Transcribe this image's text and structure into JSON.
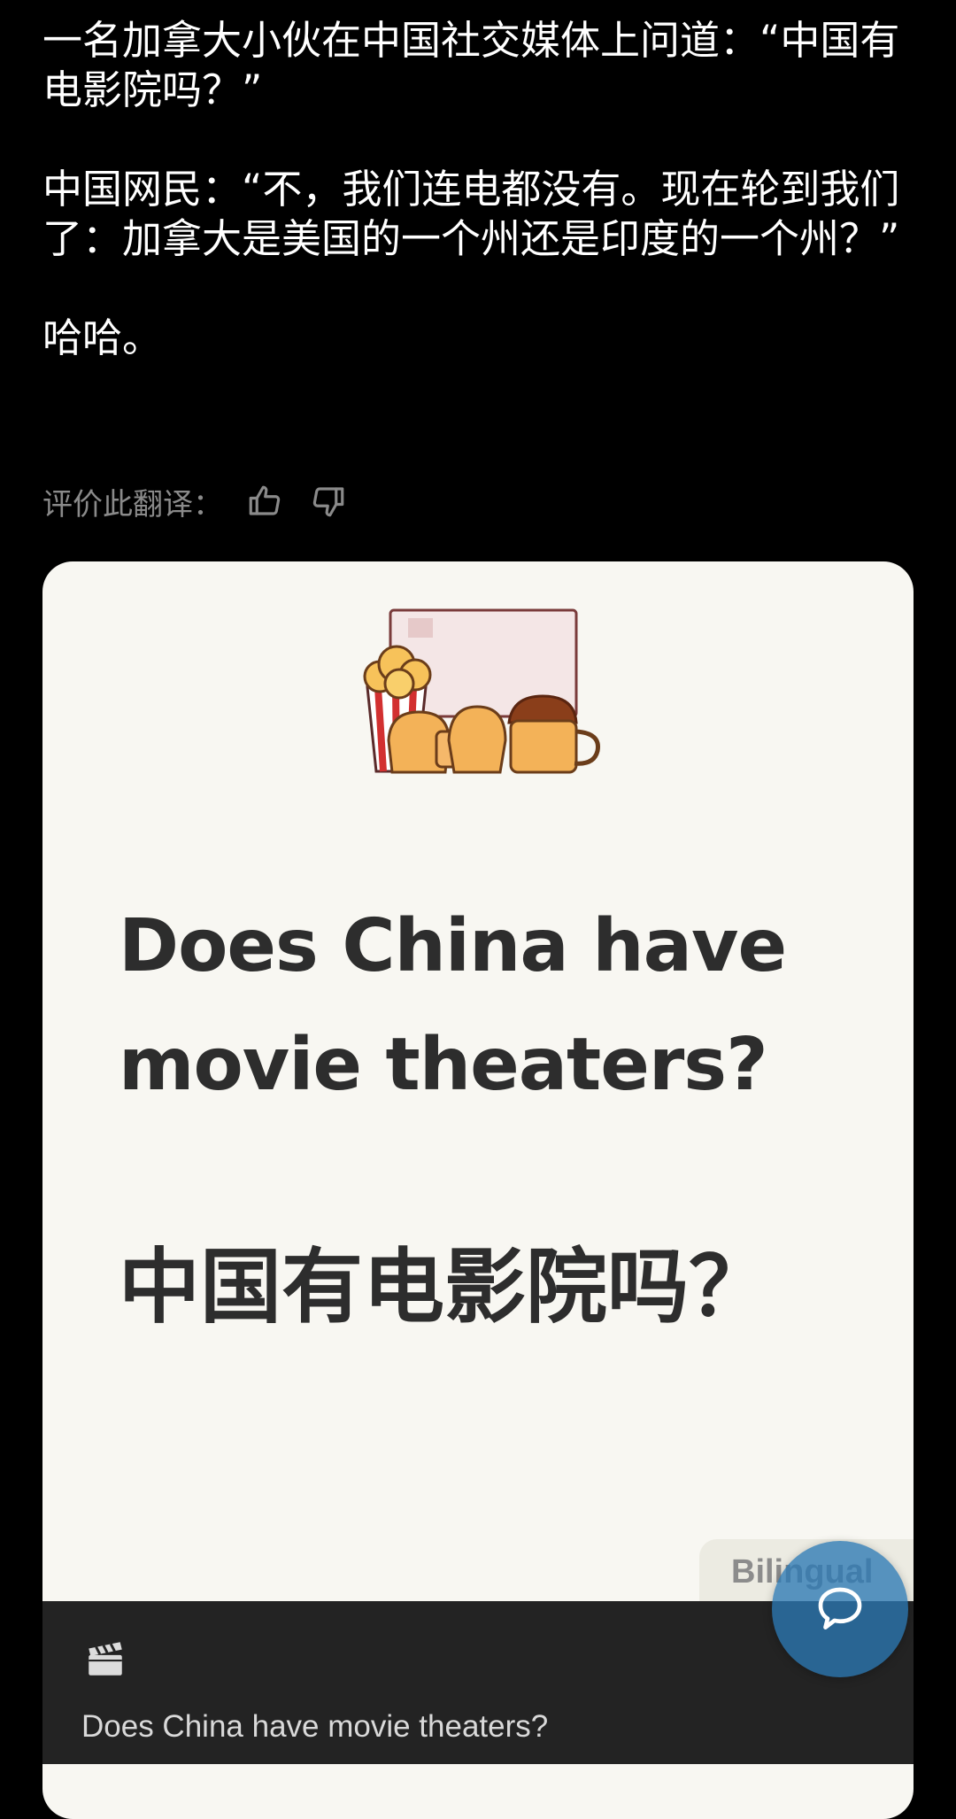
{
  "post": {
    "paragraphs": [
      "一名加拿大小伙在中国社交媒体上问道：“中国有电影院吗？”",
      "中国网民：“不，我们连电都没有。现在轮到我们了：加拿大是美国的一个州还是印度的一个州？”",
      "哈哈。"
    ]
  },
  "translation_rating": {
    "label": "评价此翻译：",
    "thumbs_up_icon": "thumbs-up-icon",
    "thumbs_down_icon": "thumbs-down-icon"
  },
  "card": {
    "title_en": "Does China have movie theaters?",
    "title_zh": "中国有电影院吗？",
    "tag": "Bilingual",
    "illustration_icon": "popcorn-snacks-illustration",
    "background_color": "#f8f7f2",
    "text_color": "#2d2d2d"
  },
  "bottom_bar": {
    "icon": "clapperboard-icon",
    "caption": "Does China have movie theaters?"
  },
  "fab": {
    "icon": "chat-bubble-icon",
    "color": "#2b78b4"
  }
}
